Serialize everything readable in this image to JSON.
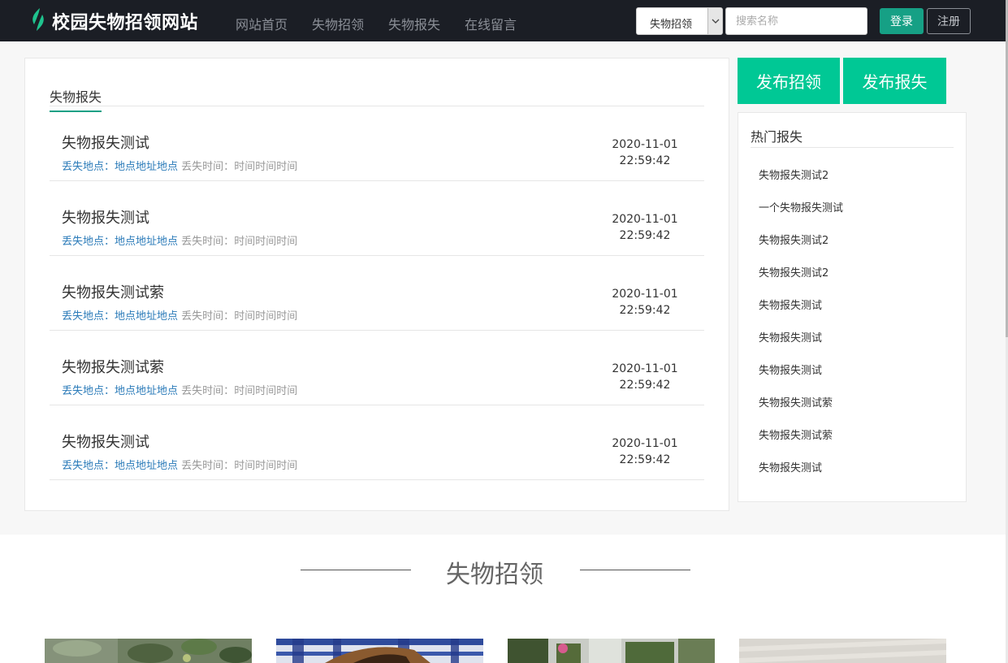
{
  "header": {
    "site_title": "校园失物招领网站",
    "nav": [
      "网站首页",
      "失物招领",
      "失物报失",
      "在线留言"
    ],
    "search": {
      "category_selected": "失物招领",
      "placeholder": "搜索名称"
    },
    "login_label": "登录",
    "register_label": "注册"
  },
  "lost_panel": {
    "tab_label": "失物报失",
    "items": [
      {
        "title": "失物报失测试",
        "place_label": "丢失地点：",
        "place": "地点地址地点",
        "time_label": "丢失时间：",
        "time": "时间时间时间",
        "date": "2020-11-01",
        "clock": "22:59:42"
      },
      {
        "title": "失物报失测试",
        "place_label": "丢失地点：",
        "place": "地点地址地点",
        "time_label": "丢失时间：",
        "time": "时间时间时间",
        "date": "2020-11-01",
        "clock": "22:59:42"
      },
      {
        "title": "失物报失测试萦",
        "place_label": "丢失地点：",
        "place": "地点地址地点",
        "time_label": "丢失时间：",
        "time": "时间时间时间",
        "date": "2020-11-01",
        "clock": "22:59:42"
      },
      {
        "title": "失物报失测试萦",
        "place_label": "丢失地点：",
        "place": "地点地址地点",
        "time_label": "丢失时间：",
        "time": "时间时间时间",
        "date": "2020-11-01",
        "clock": "22:59:42"
      },
      {
        "title": "失物报失测试",
        "place_label": "丢失地点：",
        "place": "地点地址地点",
        "time_label": "丢失时间：",
        "time": "时间时间时间",
        "date": "2020-11-01",
        "clock": "22:59:42"
      }
    ]
  },
  "actions": {
    "publish_found_label": "发布招领",
    "publish_lost_label": "发布报失"
  },
  "hot_panel": {
    "title": "热门报失",
    "items": [
      "失物报失测试2",
      "一个失物报失测试",
      "失物报失测试2",
      "失物报失测试2",
      "失物报失测试",
      "失物报失测试",
      "失物报失测试",
      "失物报失测试萦",
      "失物报失测试萦",
      "失物报失测试"
    ]
  },
  "found_section": {
    "title": "失物招领"
  },
  "colors": {
    "navbar_bg": "#1b1e25",
    "accent_green": "#16a085",
    "publish_green": "#00c895",
    "link_blue": "#2b7bb9"
  }
}
